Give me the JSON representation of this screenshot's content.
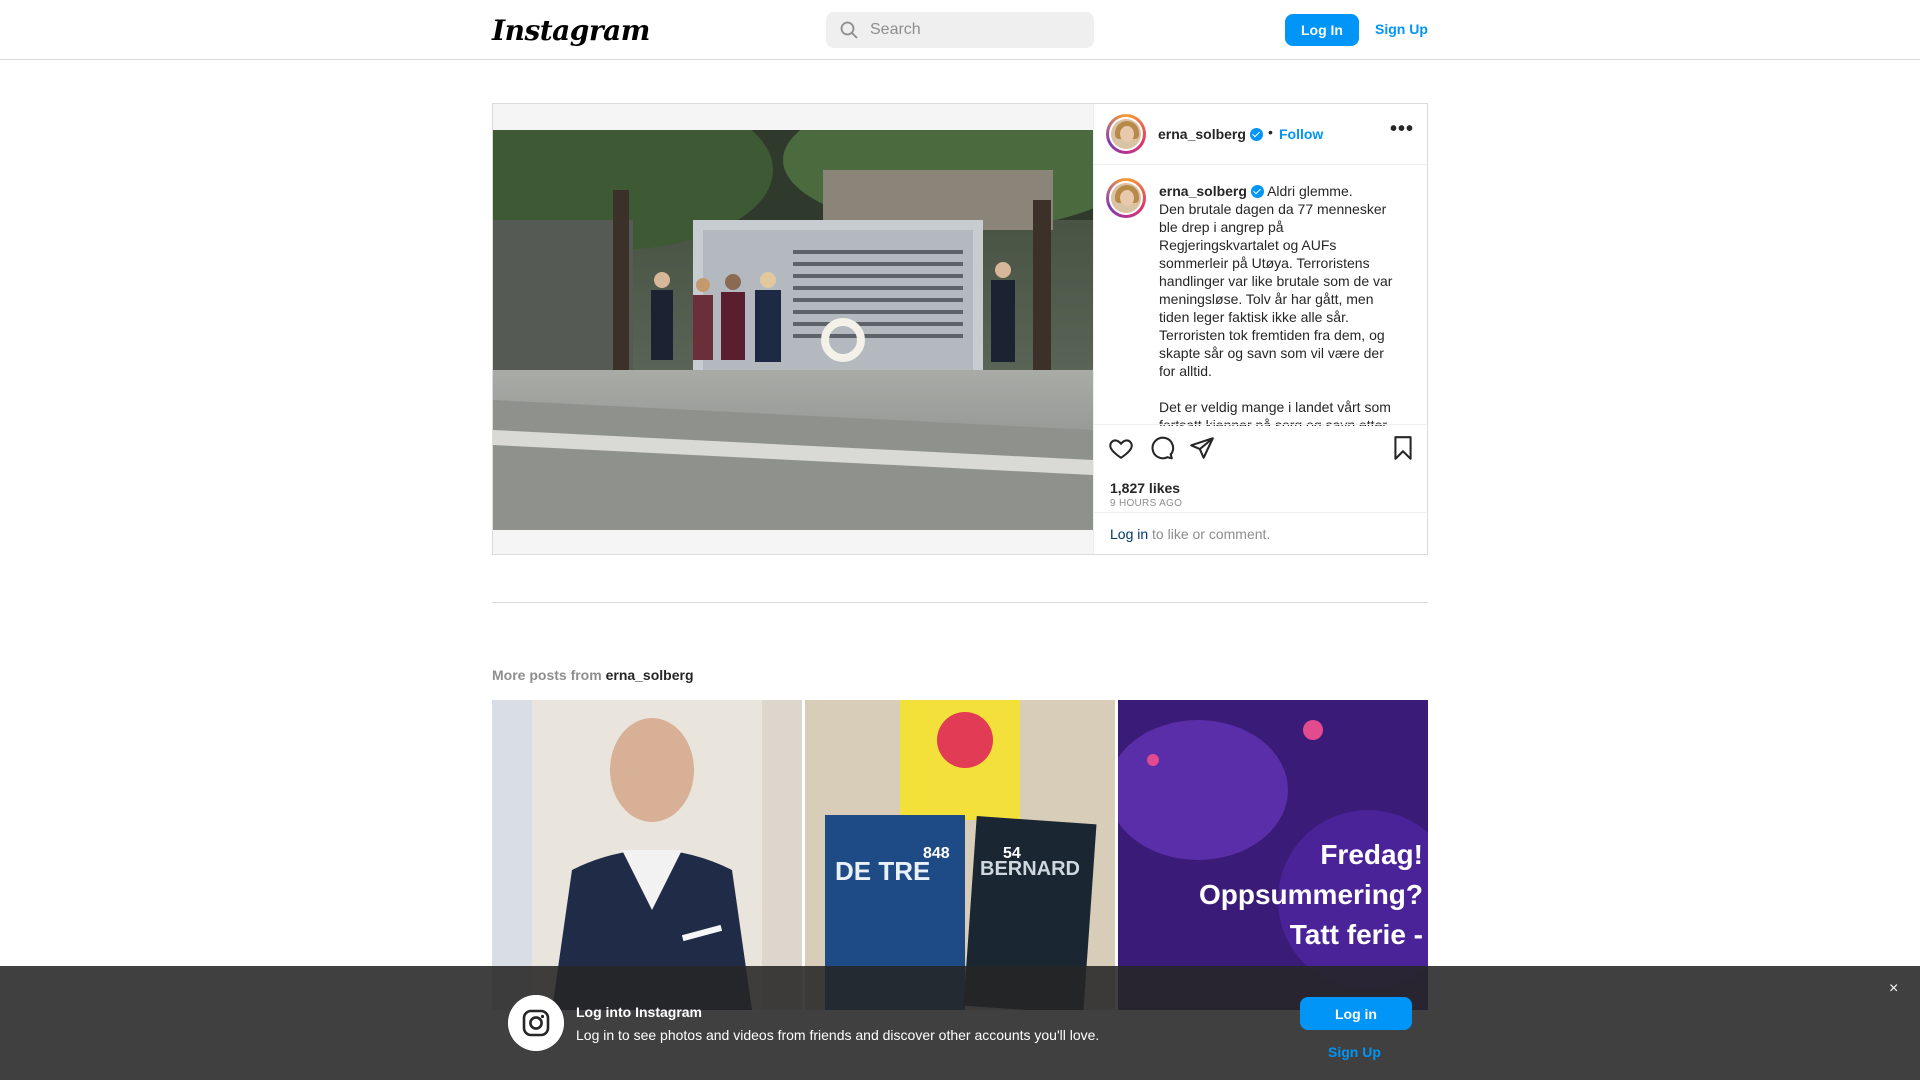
{
  "app": {
    "logo_text": "Instagram"
  },
  "header": {
    "search_placeholder": "Search",
    "login_label": "Log In",
    "signup_label": "Sign Up"
  },
  "post": {
    "username": "erna_solberg",
    "follow_label": "Follow",
    "separator": "•",
    "caption": "Aldri glemme.\nDen brutale dagen da 77 mennesker ble drep i angrep på Regjeringskvartalet og AUFs sommerleir på Utøya. Terroristens handlinger var like brutale som de var meningsløse. Tolv år har gått, men tiden leger faktisk ikke alle sår. Terroristen tok fremtiden fra dem, og skapte sår og savn som vil være der for alltid.\n\nDet er veldig mange i landet vårt som fortsatt kjenner på sorg og savn etter",
    "likes": "1,827 likes",
    "time_ago": "9 HOURS AGO",
    "login_link": "Log in",
    "login_suffix": " to like or comment."
  },
  "more_posts": {
    "prefix": "More posts from ",
    "username": "erna_solberg",
    "tiles": [
      {
        "overlay_count": ""
      },
      {
        "overlay_count_1": "848",
        "overlay_count_2": "54"
      },
      {
        "overlay_text": "Fredag!\nOppsummering?\nTatt ferie -"
      }
    ]
  },
  "banner": {
    "title": "Log into Instagram",
    "subtitle": "Log in to see photos and videos from friends and discover other accounts you'll love.",
    "login_label": "Log in",
    "signup_label": "Sign Up",
    "close_glyph": "×"
  },
  "icons": [
    "search-icon",
    "more-icon",
    "heart-icon",
    "comment-icon",
    "share-icon",
    "bookmark-icon",
    "verified-badge-icon",
    "instagram-glyph-icon",
    "close-icon"
  ],
  "colors": {
    "accent": "#0095f6",
    "text": "#262626",
    "muted": "#8e8e8e",
    "border": "#dbdbdb"
  }
}
